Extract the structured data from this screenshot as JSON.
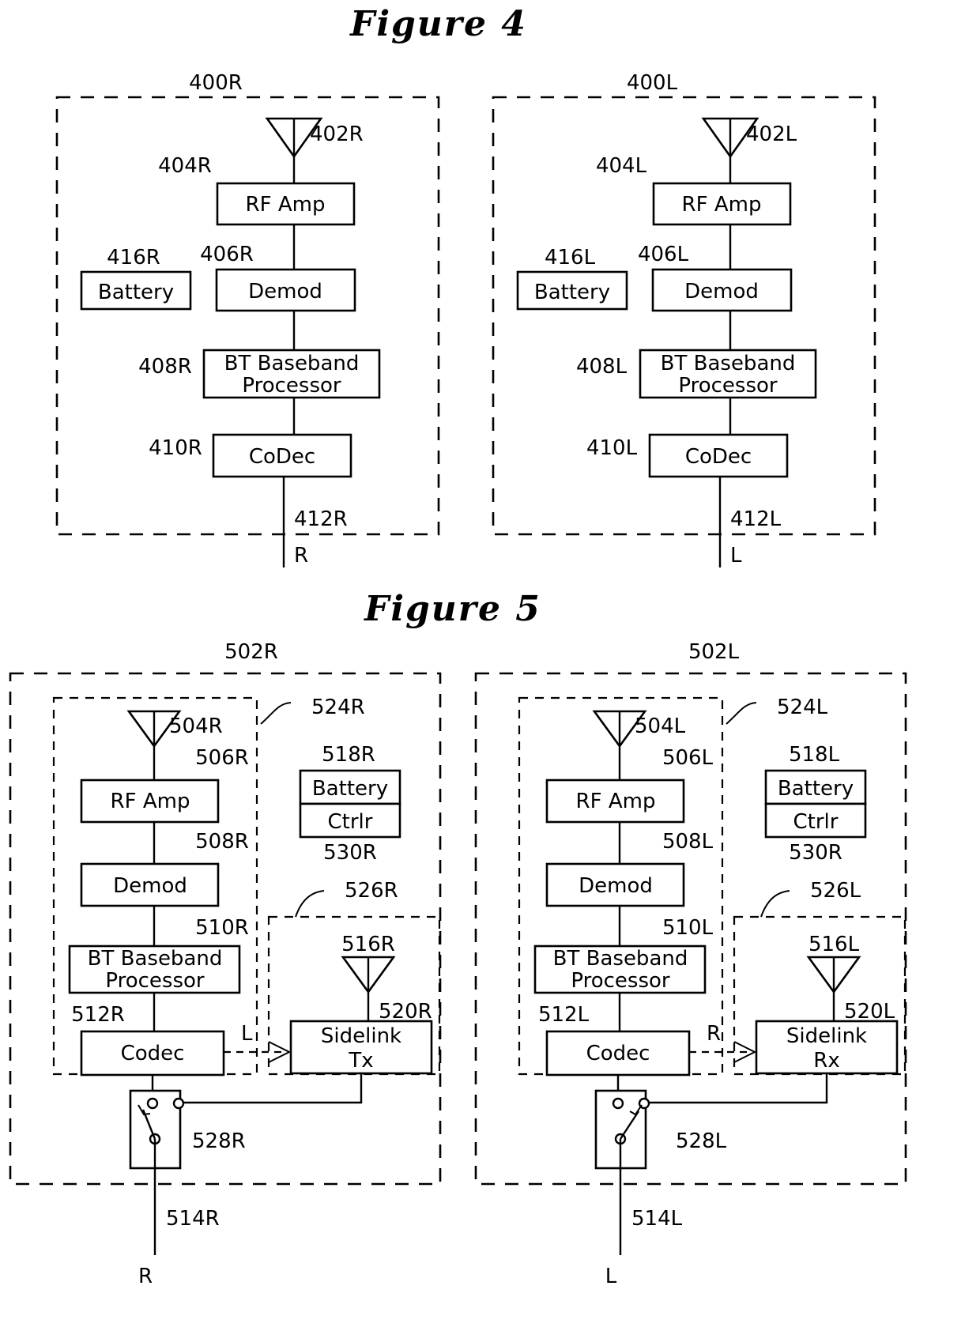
{
  "figures": [
    {
      "title": "Figure  4",
      "panels": [
        {
          "id": "400R",
          "antenna": "402R",
          "blocks": [
            {
              "ref": "404R",
              "label": "RF  Amp"
            },
            {
              "ref": "406R",
              "label": "Demod"
            },
            {
              "ref": "408R",
              "label_line1": "BT  Baseband",
              "label_line2": "Processor"
            },
            {
              "ref": "410R",
              "label": "CoDec"
            }
          ],
          "battery": {
            "ref": "416R",
            "label": "Battery"
          },
          "output": {
            "ref": "412R",
            "signal": "R"
          }
        },
        {
          "id": "400L",
          "antenna": "402L",
          "blocks": [
            {
              "ref": "404L",
              "label": "RF  Amp"
            },
            {
              "ref": "406L",
              "label": "Demod"
            },
            {
              "ref": "408L",
              "label_line1": "BT  Baseband",
              "label_line2": "Processor"
            },
            {
              "ref": "410L",
              "label": "CoDec"
            }
          ],
          "battery": {
            "ref": "416L",
            "label": "Battery"
          },
          "output": {
            "ref": "412L",
            "signal": "L"
          }
        }
      ]
    },
    {
      "title": "Figure  5",
      "panels": [
        {
          "id": "502R",
          "inner_left_ref": "524R",
          "inner_right_ref": "526R",
          "antenna": "504R",
          "blocks": [
            {
              "ref": "506R",
              "label": "RF  Amp"
            },
            {
              "ref": "508R",
              "label": "Demod"
            },
            {
              "ref": "510R",
              "label_line1": "BT  Baseband",
              "label_line2": "Processor"
            },
            {
              "ref": "512R",
              "label": "Codec"
            }
          ],
          "power": {
            "ref_top": "518R",
            "label_top": "Battery",
            "label_bottom": "Ctrlr",
            "ref_bottom": "530R"
          },
          "sidelink": {
            "antenna_ref": "516R",
            "ref": "520R",
            "label_line1": "Sidelink",
            "label_line2": "Tx"
          },
          "codec_out_label": "L",
          "switch": {
            "ref": "528R",
            "blade": "left"
          },
          "output": {
            "ref": "514R",
            "signal": "R"
          }
        },
        {
          "id": "502L",
          "inner_left_ref": "524L",
          "inner_right_ref": "526L",
          "antenna": "504L",
          "blocks": [
            {
              "ref": "506L",
              "label": "RF  Amp"
            },
            {
              "ref": "508L",
              "label": "Demod"
            },
            {
              "ref": "510L",
              "label_line1": "BT  Baseband",
              "label_line2": "Processor"
            },
            {
              "ref": "512L",
              "label": "Codec"
            }
          ],
          "power": {
            "ref_top": "518L",
            "label_top": "Battery",
            "label_bottom": "Ctrlr",
            "ref_bottom": "530R"
          },
          "sidelink": {
            "antenna_ref": "516L",
            "ref": "520L",
            "label_line1": "Sidelink",
            "label_line2": "Rx"
          },
          "codec_out_label": "R",
          "switch": {
            "ref": "528L",
            "blade": "right"
          },
          "output": {
            "ref": "514L",
            "signal": "L"
          }
        }
      ]
    }
  ],
  "colors": {
    "ink": "#000000",
    "paper": "#ffffff"
  }
}
